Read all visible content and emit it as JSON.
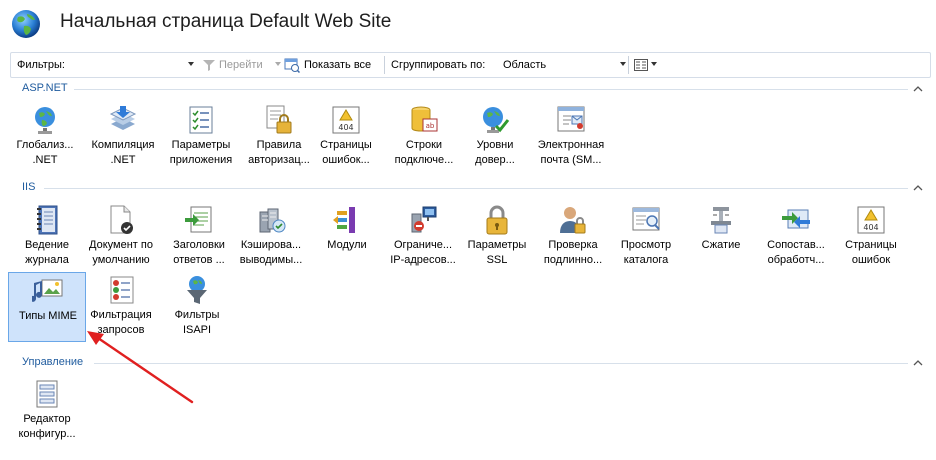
{
  "header": {
    "title": "Начальная страница Default Web Site"
  },
  "toolbar": {
    "filters_label": "Фильтры:",
    "go_label": "Перейти",
    "show_all_label": "Показать все",
    "group_by_label": "Сгруппировать по:",
    "group_by_value": "Область"
  },
  "groups": {
    "aspnet": {
      "label": "ASP.NET",
      "tiles": [
        {
          "l1": "Глобализ...",
          "l2": ".NET"
        },
        {
          "l1": "Компиляция",
          "l2": ".NET"
        },
        {
          "l1": "Параметры",
          "l2": "приложения"
        },
        {
          "l1": "Правила",
          "l2": "авторизац..."
        },
        {
          "l1": "Страницы",
          "l2": "ошибок..."
        },
        {
          "l1": "Строки",
          "l2": "подключе..."
        },
        {
          "l1": "Уровни",
          "l2": "довер..."
        },
        {
          "l1": "Электронная",
          "l2": "почта (SM..."
        }
      ]
    },
    "iis": {
      "label": "IIS",
      "tiles": [
        {
          "l1": "Ведение",
          "l2": "журнала"
        },
        {
          "l1": "Документ по",
          "l2": "умолчанию"
        },
        {
          "l1": "Заголовки",
          "l2": "ответов ..."
        },
        {
          "l1": "Кэширова...",
          "l2": "выводимы..."
        },
        {
          "l1": "Модули",
          "l2": ""
        },
        {
          "l1": "Ограниче...",
          "l2": "IP-адресов..."
        },
        {
          "l1": "Параметры",
          "l2": "SSL"
        },
        {
          "l1": "Проверка",
          "l2": "подлинно..."
        },
        {
          "l1": "Просмотр",
          "l2": "каталога"
        },
        {
          "l1": "Сжатие",
          "l2": ""
        },
        {
          "l1": "Сопостав...",
          "l2": "обработч..."
        },
        {
          "l1": "Страницы",
          "l2": "ошибок"
        },
        {
          "l1": "Типы MIME",
          "l2": ""
        },
        {
          "l1": "Фильтрация",
          "l2": "запросов"
        },
        {
          "l1": "Фильтры",
          "l2": "ISAPI"
        }
      ]
    },
    "mgmt": {
      "label": "Управление",
      "tiles": [
        {
          "l1": "Редактор",
          "l2": "конфигур..."
        }
      ]
    }
  }
}
